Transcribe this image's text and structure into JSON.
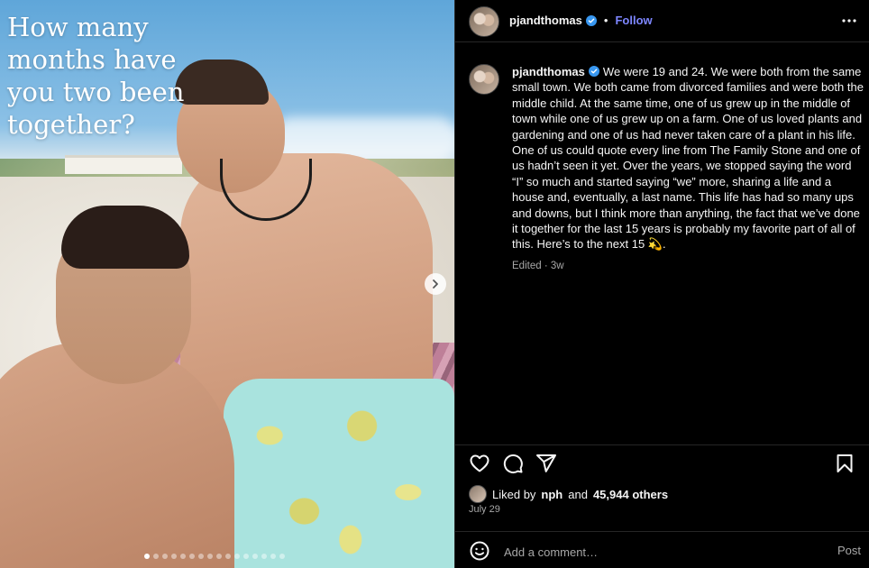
{
  "post": {
    "image": {
      "overlay_text": "How many months have you two been together?",
      "carousel_total": 16,
      "carousel_active_index": 0,
      "next_icon": "chevron-right-icon"
    },
    "header": {
      "username": "pjandthomas",
      "verified": true,
      "separator": "•",
      "follow_label": "Follow",
      "more_icon": "more-horizontal-icon"
    },
    "caption": {
      "username": "pjandthomas",
      "verified": true,
      "text": "We were 19 and 24. We were both from the same small town. We both came from divorced families and were both the middle child. At the same time, one of us grew up in the middle of town while one of us grew up on a farm. One of us loved plants and gardening and one of us had never taken care of a plant in his life. One of us could quote every line from The Family Stone and one of us hadn’t seen it yet. Over the years, we stopped saying the word “I” so much and started saying “we” more, sharing a life and a house and, eventually, a last name. This life has had so many ups and downs, but I think more than anything, the fact that we’ve done it together for the last 15 years is probably my favorite part of all of this. Here’s to the next 15 💫.",
      "edited_label": "Edited",
      "meta_separator": "·",
      "age": "3w"
    },
    "actions": {
      "like_icon": "heart-icon",
      "comment_icon": "comment-icon",
      "share_icon": "send-icon",
      "save_icon": "bookmark-icon"
    },
    "likes": {
      "prefix": "Liked by",
      "first_liker": "nph",
      "conjunction": "and",
      "others": "45,944 others"
    },
    "date": "July 29",
    "comment": {
      "emoji_icon": "emoji-icon",
      "placeholder": "Add a comment…",
      "post_label": "Post"
    },
    "colors": {
      "background": "#000000",
      "text": "#f5f5f5",
      "secondary_text": "#a8a8a8",
      "follow": "#7d86ff",
      "verified": "#3897f0",
      "divider": "#262626"
    }
  }
}
